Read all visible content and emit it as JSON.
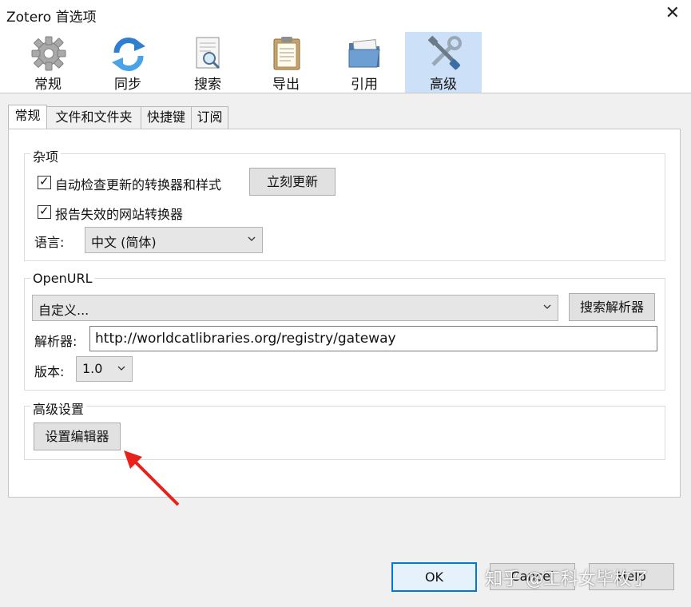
{
  "window": {
    "title": "Zotero 首选项",
    "close_glyph": "✕"
  },
  "toolbar": {
    "items": [
      {
        "label": "常规",
        "icon": "gear-icon"
      },
      {
        "label": "同步",
        "icon": "sync-icon"
      },
      {
        "label": "搜索",
        "icon": "search-document-icon"
      },
      {
        "label": "导出",
        "icon": "clipboard-icon"
      },
      {
        "label": "引用",
        "icon": "folder-icon"
      },
      {
        "label": "高级",
        "icon": "tools-icon",
        "active": true
      }
    ]
  },
  "tabs": [
    {
      "label": "常规",
      "active": true
    },
    {
      "label": "文件和文件夹"
    },
    {
      "label": "快捷键"
    },
    {
      "label": "订阅"
    }
  ],
  "misc": {
    "legend": "杂项",
    "auto_update_label": "自动检查更新的转换器和样式",
    "auto_update_checked": true,
    "update_now_label": "立刻更新",
    "report_label": "报告失效的网站转换器",
    "report_checked": true,
    "language_label": "语言:",
    "language_value": "中文 (简体)"
  },
  "openurl": {
    "legend": "OpenURL",
    "resolver_select": "自定义...",
    "search_resolvers_label": "搜索解析器",
    "resolver_label": "解析器:",
    "resolver_value": "http://worldcatlibraries.org/registry/gateway",
    "version_label": "版本:",
    "version_value": "1.0"
  },
  "advanced": {
    "legend": "高级设置",
    "config_editor_label": "设置编辑器"
  },
  "footer": {
    "ok_label": "OK",
    "cancel_label": "Cancel",
    "help_label": "Help"
  },
  "watermark": "知乎 @工科女毕枚了",
  "colors": {
    "accent": "#0078d7",
    "arrow": "#e8221b",
    "active_toolbar": "#cce0f7"
  }
}
